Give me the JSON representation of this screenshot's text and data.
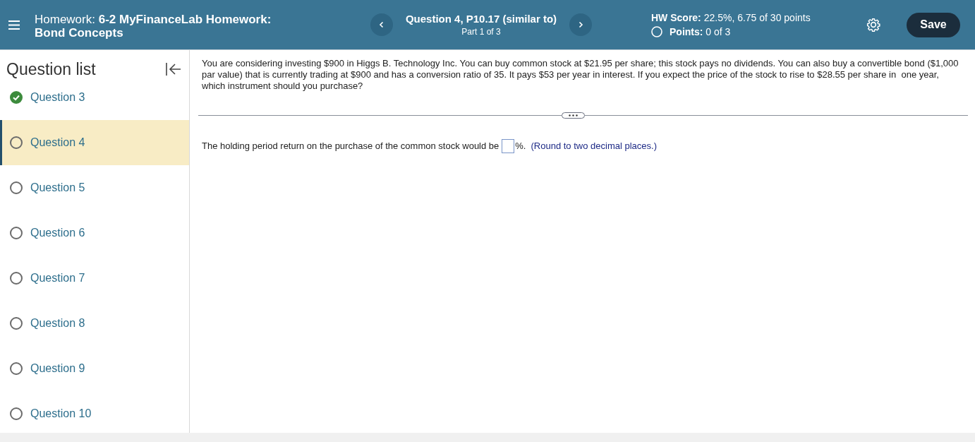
{
  "header": {
    "title": "Homework: **6-2 MyFinanceLab Homework: Bond Concepts**",
    "question_title": "Question 4, P10.17 (similar to)",
    "part": "Part 1 of 3",
    "score": "**HW Score:** 22.5%, 6.75 of 30 points",
    "points": "**Points:** 0 of 3",
    "save_button": "Save"
  },
  "sidebar": {
    "title": "Question list",
    "items": [
      {
        "label": "Question 3",
        "completed": true,
        "selected": false
      },
      {
        "label": "Question 4",
        "completed": false,
        "selected": true
      },
      {
        "label": "Question 5",
        "completed": false,
        "selected": false
      },
      {
        "label": "Question 6",
        "completed": false,
        "selected": false
      },
      {
        "label": "Question 7",
        "completed": false,
        "selected": false
      },
      {
        "label": "Question 8",
        "completed": false,
        "selected": false
      },
      {
        "label": "Question 9",
        "completed": false,
        "selected": false
      },
      {
        "label": "Question 10",
        "completed": false,
        "selected": false
      }
    ]
  },
  "question": {
    "text": "You are considering investing $900 in Higgs B. Technology Inc. You can buy common stock at $21.95 per share; this stock pays no dividends. You can also buy a convertible bond ($1,000 par value) that is currently trading at $900 and has a conversion ratio of 35. It pays $53 per year in interest. If you expect the price of the stock to rise to $28.55 per share in  one year, which instrument should you purchase?",
    "prompt": "The holding period return on the purchase of the common stock would be",
    "unit": "%.",
    "hint": "(Round to two decimal places.)"
  }
}
